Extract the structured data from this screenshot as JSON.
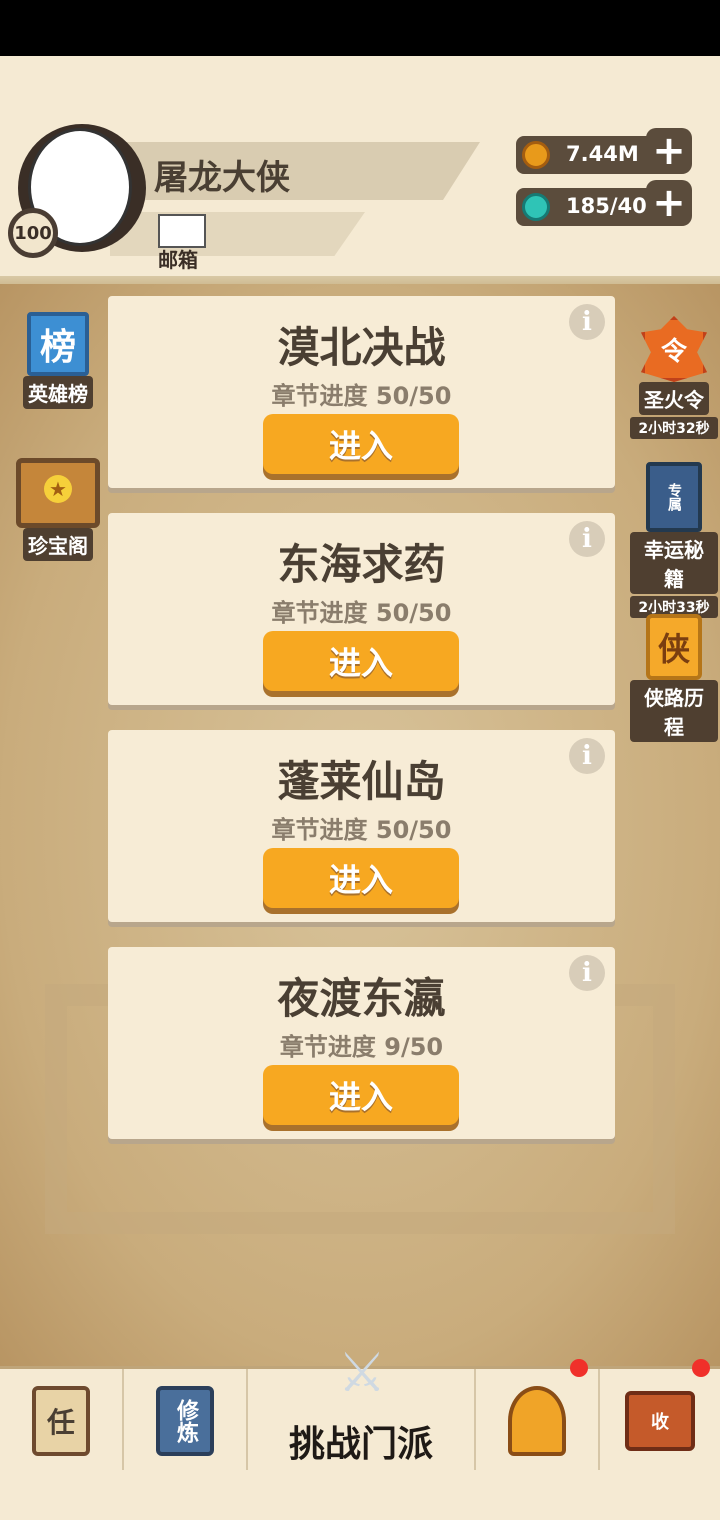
{
  "player": {
    "name": "屠龙大侠",
    "level": "100"
  },
  "mail": {
    "label": "邮箱"
  },
  "currencies": [
    {
      "icon": "coin-icon",
      "value": "7.44M"
    },
    {
      "icon": "gem-icon",
      "value": "185/40"
    }
  ],
  "left_menu": [
    {
      "icon_text": "榜",
      "label": "英雄榜"
    },
    {
      "label": "珍宝阁"
    }
  ],
  "right_menu": [
    {
      "icon_text": "令",
      "label": "圣火令",
      "timer": "2小时32秒"
    },
    {
      "icon_text": "专属",
      "label": "幸运秘籍",
      "timer": "2小时33秒"
    },
    {
      "icon_text": "侠",
      "label": "侠路历程"
    }
  ],
  "chapters": [
    {
      "title": "漠北决战",
      "progress": "章节进度 50/50",
      "enter": "进入"
    },
    {
      "title": "东海求药",
      "progress": "章节进度 50/50",
      "enter": "进入"
    },
    {
      "title": "蓬莱仙岛",
      "progress": "章节进度 50/50",
      "enter": "进入"
    },
    {
      "title": "夜渡东瀛",
      "progress": "章节进度 9/50",
      "enter": "进入"
    }
  ],
  "info_glyph": "i",
  "bottom_tabs": [
    {
      "icon_text": "任"
    },
    {
      "icon_text": "修炼"
    },
    {
      "label": "挑战门派"
    },
    {
      "icon_text": ""
    },
    {
      "icon_text": "收"
    }
  ],
  "colors": {
    "accent_button": "#f7a821",
    "card_bg": "#f7ecd6",
    "badge_red": "#f0302a"
  }
}
